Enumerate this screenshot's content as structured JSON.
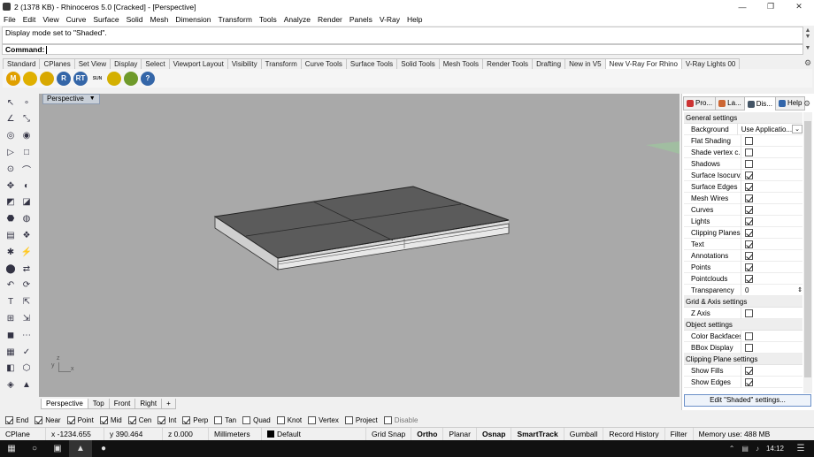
{
  "window": {
    "title": "2 (1378 KB) - Rhinoceros 5.0 [Cracked] - [Perspective]"
  },
  "menu": [
    "File",
    "Edit",
    "View",
    "Curve",
    "Surface",
    "Solid",
    "Mesh",
    "Dimension",
    "Transform",
    "Tools",
    "Analyze",
    "Render",
    "Panels",
    "V-Ray",
    "Help"
  ],
  "command": {
    "history": "Display mode set to \"Shaded\".",
    "prompt_label": "Command:",
    "value": ""
  },
  "toolbar_tabs": [
    "Standard",
    "CPlanes",
    "Set View",
    "Display",
    "Select",
    "Viewport Layout",
    "Visibility",
    "Transform",
    "Curve Tools",
    "Surface Tools",
    "Solid Tools",
    "Mesh Tools",
    "Render Tools",
    "Drafting",
    "New in V5",
    "New V-Ray For Rhino",
    "V-Ray Lights 00"
  ],
  "active_toolbar_tab": "New V-Ray For Rhino",
  "toolbar_buttons": [
    {
      "icon": "vray-m-icon",
      "text": "M",
      "color": "#e0a000"
    },
    {
      "icon": "vray-light-icon",
      "text": "",
      "color": "#e0b000"
    },
    {
      "icon": "vray-material-icon",
      "text": "",
      "color": "#d8a800"
    },
    {
      "icon": "vray-r-icon",
      "text": "R",
      "color": "#3466a8"
    },
    {
      "icon": "vray-rt-icon",
      "text": "RT",
      "color": "#3466a8"
    },
    {
      "icon": "vray-sun-icon",
      "text": "SUN",
      "color": "#e8b800"
    },
    {
      "icon": "vray-dome-icon",
      "text": "",
      "color": "#d4b000"
    },
    {
      "icon": "vray-options-icon",
      "text": "",
      "color": "#6f9a2a"
    },
    {
      "icon": "vray-help-icon",
      "text": "?",
      "color": "#3466a8"
    }
  ],
  "viewport": {
    "title": "Perspective",
    "axes": {
      "y": "y",
      "z": "z",
      "x": "x"
    }
  },
  "viewport_tabs": [
    "Perspective",
    "Top",
    "Front",
    "Right",
    "+"
  ],
  "panel": {
    "tabs": [
      "Pro...",
      "La...",
      "Dis...",
      "Help"
    ],
    "sections": [
      {
        "title": "General settings",
        "rows": [
          {
            "label": "Background",
            "type": "select",
            "value": "Use Applicatio..."
          },
          {
            "label": "Flat Shading",
            "type": "check",
            "checked": false
          },
          {
            "label": "Shade vertex c...",
            "type": "check",
            "checked": false
          },
          {
            "label": "Shadows",
            "type": "check",
            "checked": false
          },
          {
            "label": "Surface Isocurv...",
            "type": "check",
            "checked": true
          },
          {
            "label": "Surface Edges",
            "type": "check",
            "checked": true
          },
          {
            "label": "Mesh Wires",
            "type": "check",
            "checked": true
          },
          {
            "label": "Curves",
            "type": "check",
            "checked": true
          },
          {
            "label": "Lights",
            "type": "check",
            "checked": true
          },
          {
            "label": "Clipping Planes",
            "type": "check",
            "checked": true
          },
          {
            "label": "Text",
            "type": "check",
            "checked": true
          },
          {
            "label": "Annotations",
            "type": "check",
            "checked": true
          },
          {
            "label": "Points",
            "type": "check",
            "checked": true
          },
          {
            "label": "Pointclouds",
            "type": "check",
            "checked": true
          },
          {
            "label": "Transparency",
            "type": "spin",
            "value": "0"
          }
        ]
      },
      {
        "title": "Grid & Axis settings",
        "rows": [
          {
            "label": "Z Axis",
            "type": "check",
            "checked": false
          }
        ]
      },
      {
        "title": "Object settings",
        "rows": [
          {
            "label": "Color Backfaces",
            "type": "check",
            "checked": false
          },
          {
            "label": "BBox Display",
            "type": "check",
            "checked": false
          }
        ]
      },
      {
        "title": "Clipping Plane settings",
        "rows": [
          {
            "label": "Show Fills",
            "type": "check",
            "checked": true
          },
          {
            "label": "Show Edges",
            "type": "check",
            "checked": true
          }
        ]
      }
    ],
    "edit_button": "Edit \"Shaded\" settings..."
  },
  "osnaps": [
    {
      "label": "End",
      "checked": true
    },
    {
      "label": "Near",
      "checked": true
    },
    {
      "label": "Point",
      "checked": true
    },
    {
      "label": "Mid",
      "checked": true
    },
    {
      "label": "Cen",
      "checked": true
    },
    {
      "label": "Int",
      "checked": true
    },
    {
      "label": "Perp",
      "checked": true
    },
    {
      "label": "Tan",
      "checked": false
    },
    {
      "label": "Quad",
      "checked": false
    },
    {
      "label": "Knot",
      "checked": false
    },
    {
      "label": "Vertex",
      "checked": false
    },
    {
      "label": "Project",
      "checked": false
    },
    {
      "label": "Disable",
      "checked": false
    }
  ],
  "status": {
    "cplane": "CPlane",
    "x": "x -1234.655",
    "y": "y 390.464",
    "z": "z 0.000",
    "units": "Millimeters",
    "layer": "Default",
    "toggles": [
      {
        "label": "Grid Snap",
        "bold": false
      },
      {
        "label": "Ortho",
        "bold": true
      },
      {
        "label": "Planar",
        "bold": false
      },
      {
        "label": "Osnap",
        "bold": true
      },
      {
        "label": "SmartTrack",
        "bold": true
      },
      {
        "label": "Gumball",
        "bold": false
      },
      {
        "label": "Record History",
        "bold": false
      },
      {
        "label": "Filter",
        "bold": false
      }
    ],
    "memory": "Memory use: 488 MB"
  },
  "taskbar": {
    "time": "14:12"
  }
}
